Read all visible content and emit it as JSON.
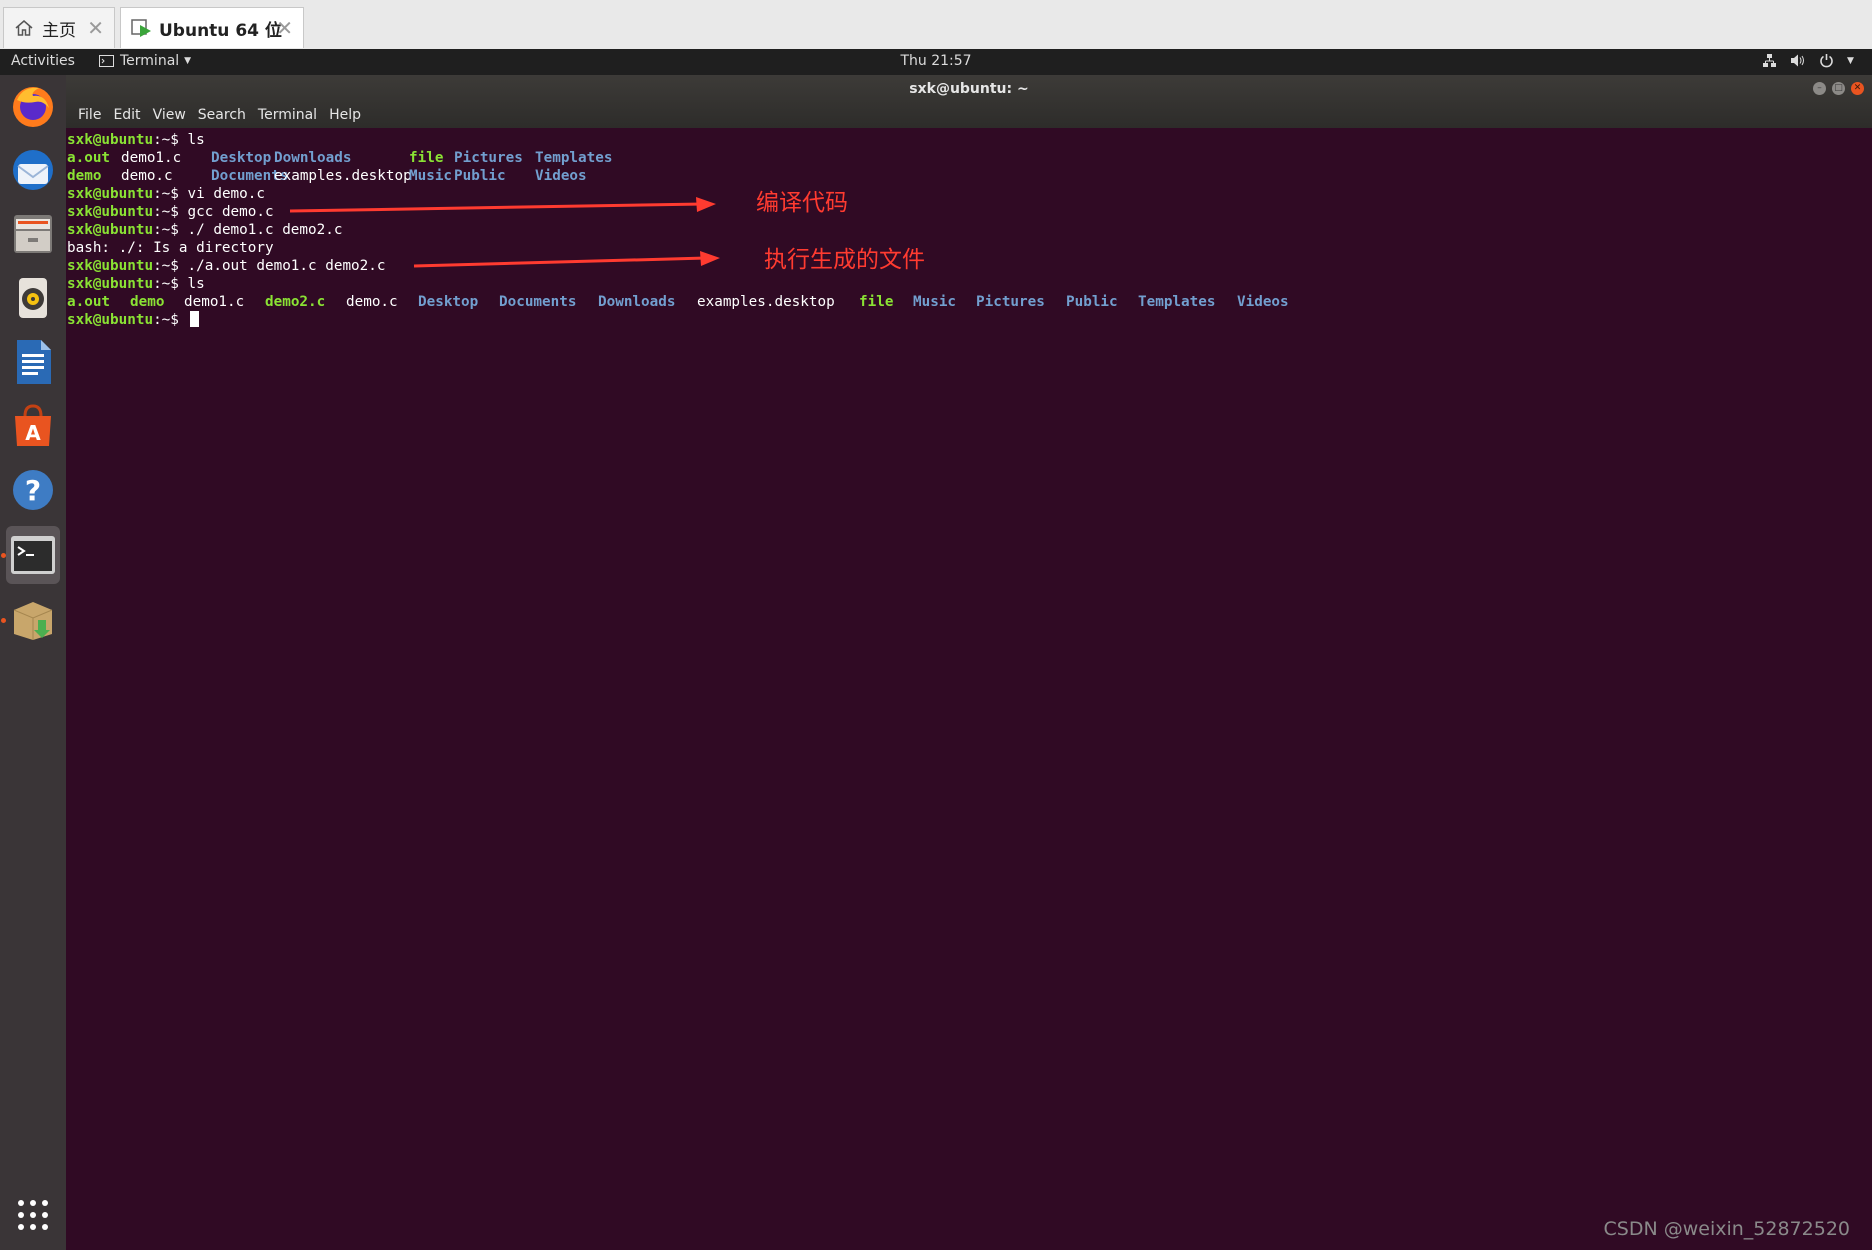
{
  "vmware": {
    "tabs": [
      {
        "label": "主页",
        "icon": "home-icon",
        "active": false
      },
      {
        "label": "Ubuntu 64 位",
        "icon": "vm-play-icon",
        "active": true
      }
    ]
  },
  "topbar": {
    "activities": "Activities",
    "app_menu": "Terminal",
    "clock": "Thu 21:57"
  },
  "dock": {
    "apps": [
      {
        "name": "firefox-icon"
      },
      {
        "name": "thunderbird-icon"
      },
      {
        "name": "files-icon"
      },
      {
        "name": "rhythmbox-icon"
      },
      {
        "name": "libreoffice-writer-icon"
      },
      {
        "name": "software-center-icon"
      },
      {
        "name": "help-icon"
      },
      {
        "name": "terminal-icon",
        "running": true
      },
      {
        "name": "package-installer-icon",
        "running": true
      }
    ],
    "show_apps": "show-applications-icon"
  },
  "terminal": {
    "title": "sxk@ubuntu: ~",
    "menu": [
      "File",
      "Edit",
      "View",
      "Search",
      "Terminal",
      "Help"
    ],
    "prompt": "sxk@ubuntu",
    "prompt_suffix": ":~$ ",
    "lines": [
      {
        "type": "cmd",
        "cmd": "ls"
      },
      {
        "type": "ls"
      },
      {
        "type": "ls"
      },
      {
        "type": "cmd",
        "cmd": "vi demo.c"
      },
      {
        "type": "cmd",
        "cmd": "gcc demo.c"
      },
      {
        "type": "cmd",
        "cmd": "./ demo1.c demo2.c"
      },
      {
        "type": "out",
        "text": "bash: ./: Is a directory"
      },
      {
        "type": "cmd",
        "cmd": "./a.out demo1.c demo2.c"
      },
      {
        "type": "cmd",
        "cmd": "ls"
      },
      {
        "type": "ls"
      },
      {
        "type": "cmd",
        "cmd": ""
      }
    ],
    "ls1": [
      [
        "a.out",
        "exec"
      ],
      [
        "demo1.c",
        "file"
      ],
      [
        "Desktop",
        "dir"
      ],
      [
        "Downloads",
        "dir"
      ],
      [
        "file",
        "exec"
      ],
      [
        "Pictures",
        "dir"
      ],
      [
        "Templates",
        "dir"
      ],
      [
        "demo",
        "exec"
      ],
      [
        "demo.c",
        "file"
      ],
      [
        "Documents",
        "dir"
      ],
      [
        "examples.desktop",
        "file"
      ],
      [
        "Music",
        "dir"
      ],
      [
        "Public",
        "dir"
      ],
      [
        "Videos",
        "dir"
      ]
    ],
    "ls2": [
      [
        "a.out",
        "exec"
      ],
      [
        "demo",
        "exec"
      ],
      [
        "demo1.c",
        "file"
      ],
      [
        "demo2.c",
        "exec"
      ],
      [
        "demo.c",
        "file"
      ],
      [
        "Desktop",
        "dir"
      ],
      [
        "Documents",
        "dir"
      ],
      [
        "Downloads",
        "dir"
      ],
      [
        "examples.desktop",
        "file"
      ],
      [
        "file",
        "exec"
      ],
      [
        "Music",
        "dir"
      ],
      [
        "Pictures",
        "dir"
      ],
      [
        "Public",
        "dir"
      ],
      [
        "Templates",
        "dir"
      ],
      [
        "Videos",
        "dir"
      ]
    ]
  },
  "annotations": [
    {
      "text": "编译代码"
    },
    {
      "text": "执行生成的文件"
    }
  ],
  "watermark": "CSDN @weixin_52872520",
  "colors": {
    "terminal_bg": "#300a24",
    "prompt": "#8ae234",
    "directory": "#729fcf",
    "annotation": "#ff3b30"
  }
}
